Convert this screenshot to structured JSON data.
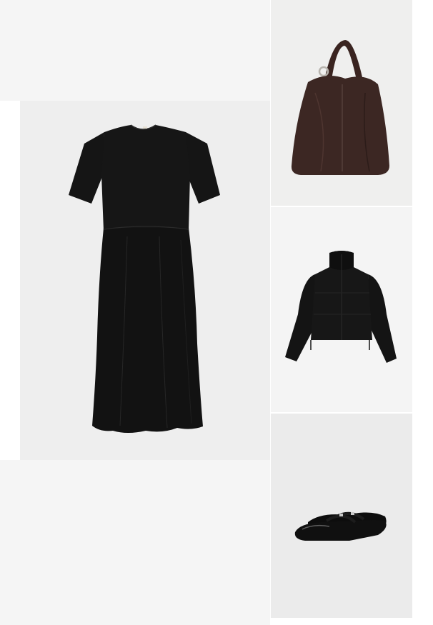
{
  "outfit": {
    "items": [
      {
        "name": "dress",
        "color": "#141414"
      },
      {
        "name": "bag",
        "color": "#3a2622"
      },
      {
        "name": "jacket",
        "color": "#141414"
      },
      {
        "name": "shoes",
        "color": "#0f0f0f"
      }
    ]
  }
}
